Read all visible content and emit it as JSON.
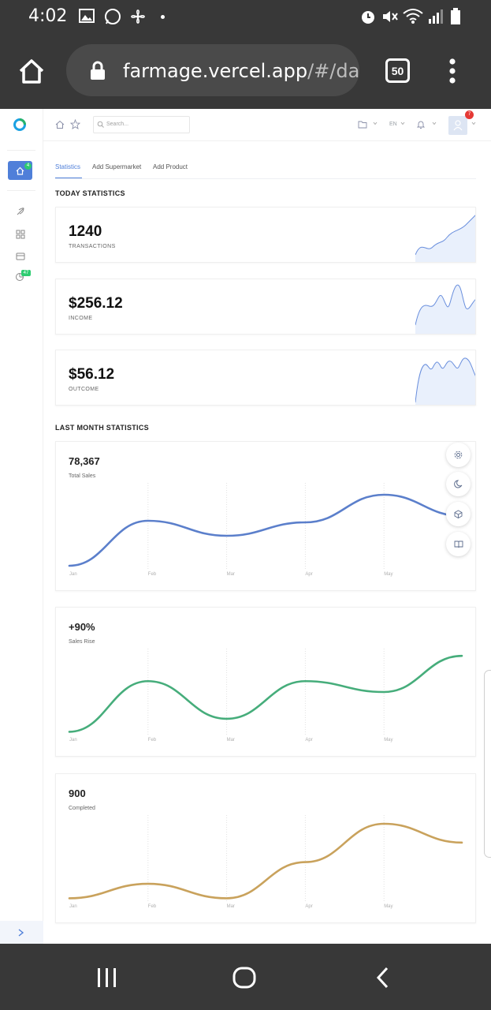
{
  "status_bar": {
    "time": "4:02"
  },
  "browser": {
    "url_domain": "farmage.vercel.app",
    "url_path": "/#/das",
    "tab_count": "50"
  },
  "topbar": {
    "search_placeholder": "Search...",
    "language": "EN",
    "notification_count": "7"
  },
  "sidebar": {
    "home_badge": "4",
    "badge_count": "47"
  },
  "tabs": [
    {
      "label": "Statistics"
    },
    {
      "label": "Add Supermarket"
    },
    {
      "label": "Add Product"
    }
  ],
  "today": {
    "title": "TODAY STATISTICS",
    "cards": [
      {
        "value": "1240",
        "label": "TRANSACTIONS"
      },
      {
        "value": "$256.12",
        "label": "INCOME"
      },
      {
        "value": "$56.12",
        "label": "OUTCOME"
      }
    ]
  },
  "last_month": {
    "title": "LAST MONTH STATISTICS"
  },
  "colors": {
    "primary": "#4f7fd9",
    "blue_line": "#5b7fcb",
    "green_line": "#46ad7b",
    "gold_line": "#c9a25c",
    "spark_fill": "#e9f0fc",
    "spark_line": "#6a8fdd"
  },
  "chart_data": [
    {
      "type": "line",
      "title": "78,367",
      "subtitle": "Total Sales",
      "categories": [
        "Jan",
        "Feb",
        "Mar",
        "Apr",
        "May"
      ],
      "x": [
        0,
        1,
        2,
        3,
        4,
        4.99
      ],
      "values": [
        5,
        62,
        43,
        60,
        95,
        68
      ],
      "ylim": [
        0,
        110
      ],
      "grid": "vertical"
    },
    {
      "type": "line",
      "title": "+90%",
      "subtitle": "Sales Rise",
      "categories": [
        "Jan",
        "Feb",
        "Mar",
        "Apr",
        "May"
      ],
      "x": [
        0,
        1,
        2,
        3,
        4,
        4.99
      ],
      "values": [
        5,
        75,
        23,
        75,
        60,
        110
      ],
      "ylim": [
        0,
        120
      ],
      "grid": "vertical"
    },
    {
      "type": "line",
      "title": "900",
      "subtitle": "Completed",
      "categories": [
        "Jan",
        "Feb",
        "Mar",
        "Apr",
        "May"
      ],
      "x": [
        0,
        1,
        2,
        3,
        4,
        4.99
      ],
      "values": [
        5,
        25,
        5,
        55,
        108,
        82
      ],
      "ylim": [
        0,
        120
      ],
      "grid": "vertical"
    }
  ]
}
